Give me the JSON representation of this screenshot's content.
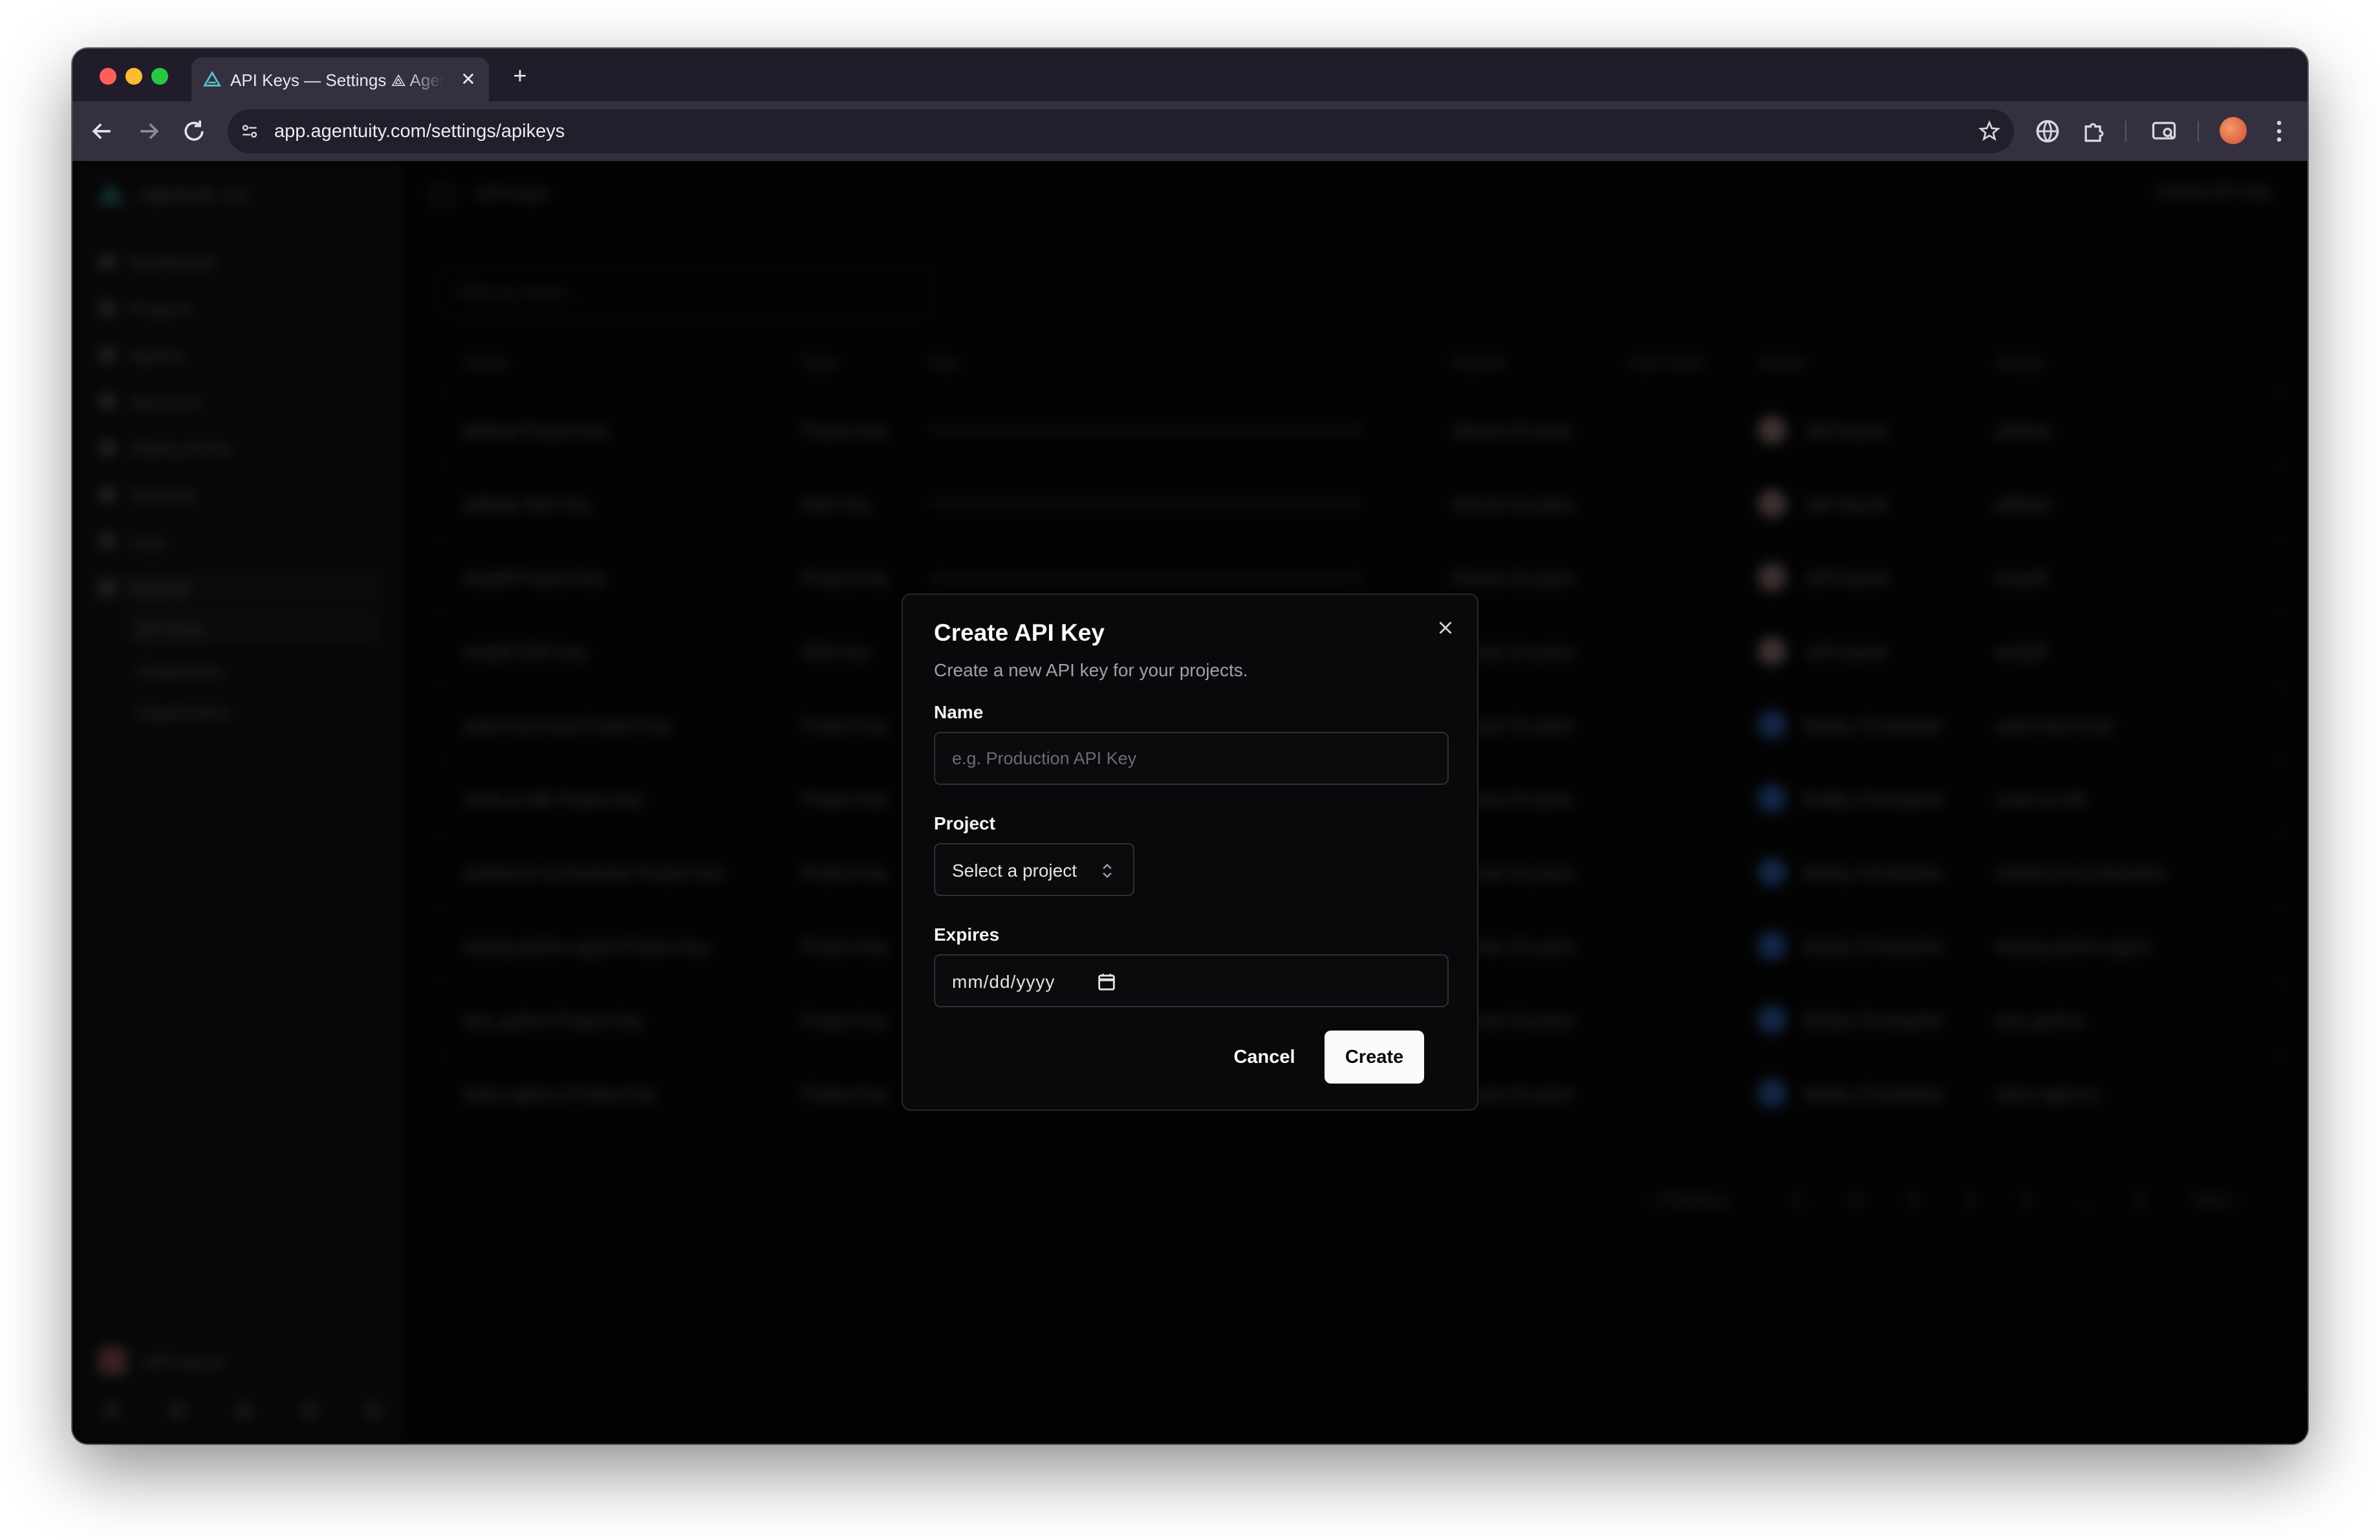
{
  "browser": {
    "tab_title": "API Keys — Settings ⟁ Agentuity",
    "url": "app.agentuity.com/settings/apikeys"
  },
  "sidebar": {
    "org_name": "Agentuity, Inc.",
    "items": [
      {
        "label": "Dashboard",
        "icon": "dashboard-icon"
      },
      {
        "label": "Projects",
        "icon": "folder-icon"
      },
      {
        "label": "Agents",
        "icon": "agent-icon"
      },
      {
        "label": "Sessions",
        "icon": "sessions-icon"
      },
      {
        "label": "Deployments",
        "icon": "deploy-icon"
      },
      {
        "label": "Services",
        "icon": "services-icon"
      },
      {
        "label": "Logs",
        "icon": "logs-icon"
      },
      {
        "label": "Settings",
        "icon": "settings-icon"
      }
    ],
    "sub_items": [
      {
        "label": "API Keys"
      },
      {
        "label": "Integrations"
      },
      {
        "label": "Organization"
      }
    ],
    "user_name": "Jeff Haynie"
  },
  "main": {
    "page_title": "API Keys",
    "create_button": "Create API Key",
    "filter_placeholder": "Filter by name...",
    "columns": [
      "Name",
      "Type",
      "Key",
      "Expires",
      "Last Used",
      "Owner",
      "Scope"
    ],
    "rows": [
      {
        "name": "jeffhaie Project Key",
        "type": "Project Key",
        "expires": "Almost 10 years",
        "owner": "Jeff Haynie",
        "scope": "jeffhaie",
        "avatar": "#c49a9a"
      },
      {
        "name": "jeffhaie SDK Key",
        "type": "SDK Key",
        "expires": "Almost 10 years",
        "owner": "Jeff Haynie",
        "scope": "jeffhaie",
        "avatar": "#c49a9a"
      },
      {
        "name": "testjeff Project Key",
        "type": "Project Key",
        "expires": "Almost 10 years",
        "owner": "Jeff Haynie",
        "scope": "testjeff",
        "avatar": "#c49a9a"
      },
      {
        "name": "testjeff SDK Key",
        "type": "SDK Key",
        "expires": "Almost 10 years",
        "owner": "Jeff Haynie",
        "scope": "testjeff",
        "avatar": "#c49a9a"
      },
      {
        "name": "poem-test-local Project Key",
        "type": "Project Key",
        "expires": "Almost 10 years",
        "owner": "Bobby Christopher",
        "scope": "poem-test-local",
        "avatar": "#3a7be0"
      },
      {
        "name": "node-ai-sdk Project Key",
        "type": "Project Key",
        "expires": "Almost 10 years",
        "owner": "Bobby Christopher",
        "scope": "node-ai-sdk",
        "avatar": "#3a7be0"
      },
      {
        "name": "testbench-orchestrator Project Key",
        "type": "Project Key",
        "expires": "Almost 10 years",
        "owner": "Bobby Christopher",
        "scope": "testbench-orchestrator",
        "avatar": "#3a7be0"
      },
      {
        "name": "testing-python-agent Project Key",
        "type": "Project Key",
        "expires": "Almost 10 years",
        "owner": "Bobby Christopher",
        "scope": "testing-python-agent",
        "avatar": "#3a7be0"
      },
      {
        "name": "test_python Project Key",
        "type": "Project Key",
        "expires": "Almost 10 years",
        "owner": "Bobby Christopher",
        "scope": "test_python",
        "avatar": "#3a7be0"
      },
      {
        "name": "basic-agent-2 Project Key",
        "type": "Project Key",
        "expires": "Almost 10 years",
        "owner": "Bobby Christopher",
        "scope": "basic-agent-2",
        "avatar": "#3a7be0"
      }
    ],
    "pagination": [
      "‹ Previous",
      "1",
      "2",
      "3",
      "4",
      "5",
      "…",
      "8",
      "Next ›"
    ]
  },
  "dialog": {
    "title": "Create API Key",
    "subtitle": "Create a new API key for your projects.",
    "name_label": "Name",
    "name_placeholder": "e.g. Production API Key",
    "name_value": "",
    "project_label": "Project",
    "project_value": "Select a project",
    "expires_label": "Expires",
    "expires_value": "mm/dd/yyyy",
    "cancel_label": "Cancel",
    "create_label": "Create"
  }
}
